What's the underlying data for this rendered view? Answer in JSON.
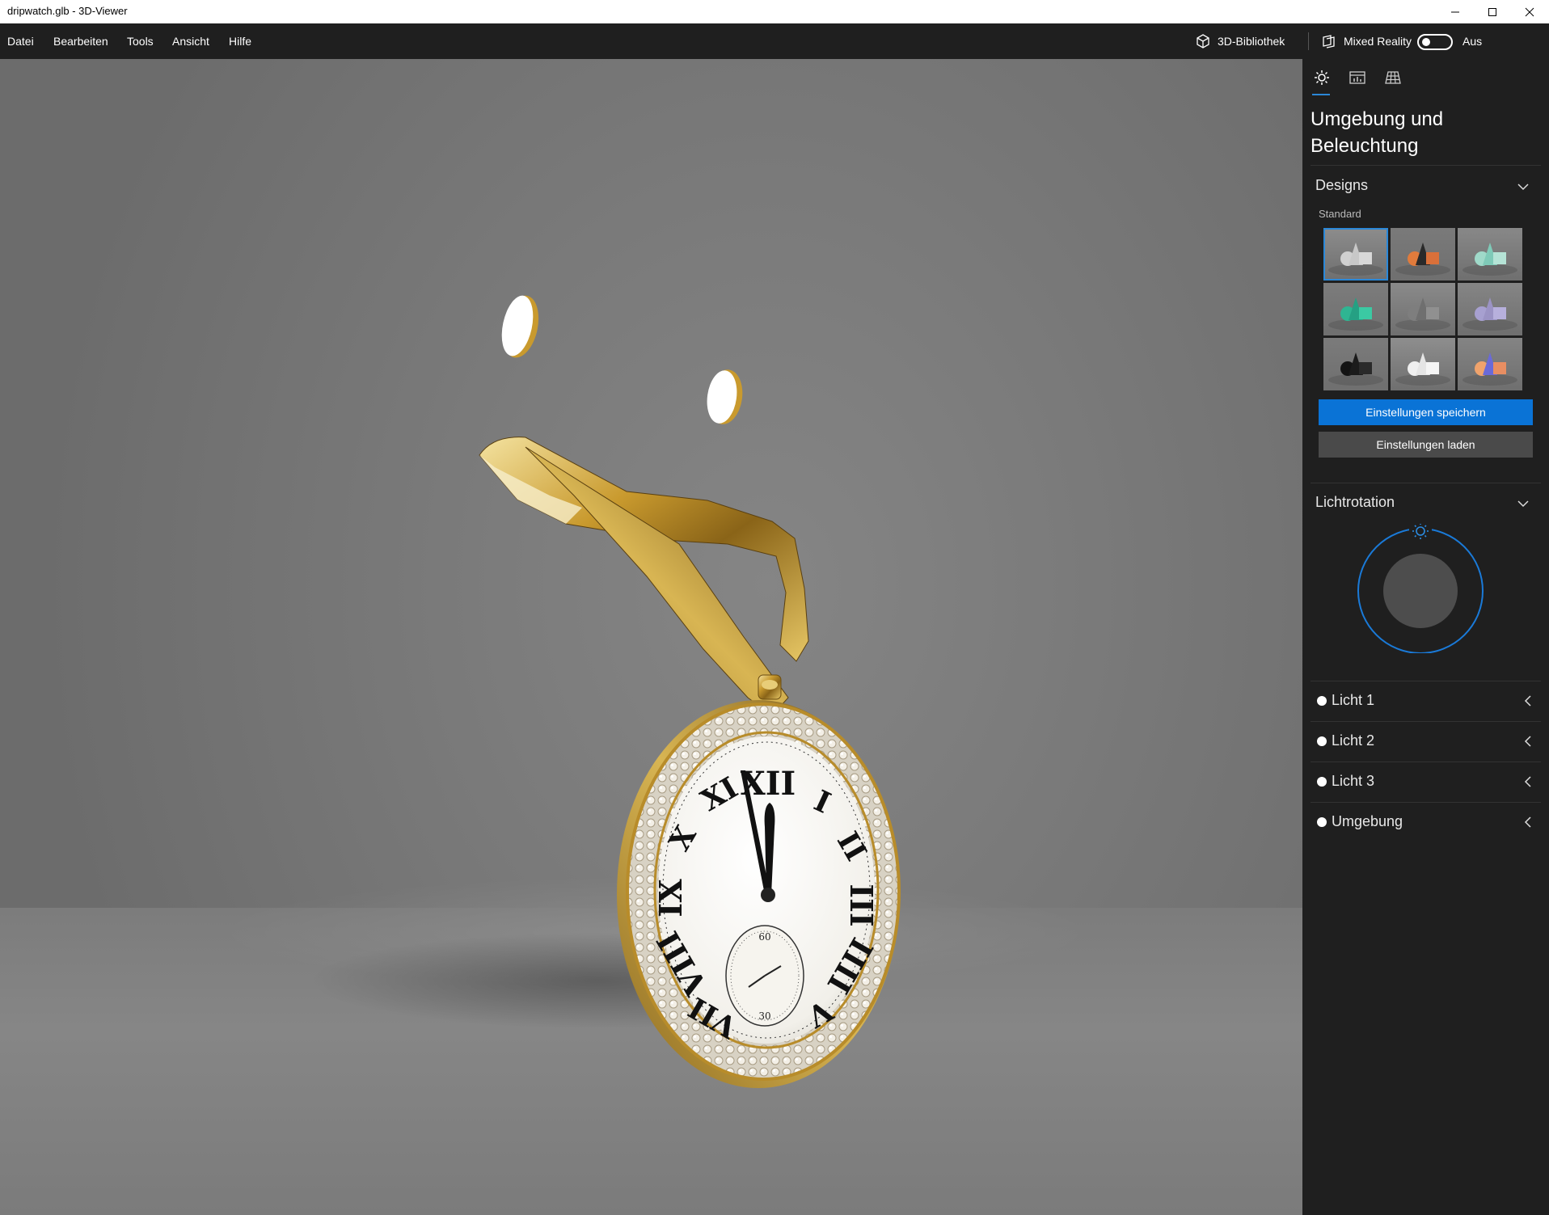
{
  "window": {
    "title": "dripwatch.glb - 3D-Viewer"
  },
  "menu": {
    "items": [
      "Datei",
      "Bearbeiten",
      "Tools",
      "Ansicht",
      "Hilfe"
    ],
    "library_label": "3D-Bibliothek",
    "mixed_reality_label": "Mixed Reality",
    "toggle_state_label": "Aus",
    "mixed_reality_on": false
  },
  "panel": {
    "tabs": [
      "environment-lighting",
      "stats-shading",
      "grid"
    ],
    "active_tab": 0,
    "title": "Umgebung und Beleuchtung",
    "designs": {
      "heading": "Designs",
      "group_label": "Standard",
      "selected_index": 0,
      "themes": [
        {
          "bg": "#8c8c8c",
          "colors": [
            "#d0d0d0",
            "#c8c8c8",
            "#d8d8d8"
          ]
        },
        {
          "bg": "#7a7a7a",
          "colors": [
            "#e07b3c",
            "#2a2a2a",
            "#d9703a"
          ]
        },
        {
          "bg": "#888888",
          "colors": [
            "#9fd9c9",
            "#7fcab8",
            "#b5e3d6"
          ]
        },
        {
          "bg": "#7c7c7c",
          "colors": [
            "#2fb592",
            "#25a083",
            "#3bc9a3"
          ]
        },
        {
          "bg": "#8a8a8a",
          "colors": [
            "#7e7e7e",
            "#6f6f6f",
            "#909090"
          ]
        },
        {
          "bg": "#858585",
          "colors": [
            "#a7a0d0",
            "#9b93c4",
            "#b7b0dc"
          ]
        },
        {
          "bg": "#7b7b7b",
          "colors": [
            "#141414",
            "#1b1b1b",
            "#2a2a2a"
          ]
        },
        {
          "bg": "#8e8e8e",
          "colors": [
            "#efefef",
            "#e5e5e5",
            "#f5f5f5"
          ]
        },
        {
          "bg": "#848484",
          "colors": [
            "#f0a36c",
            "#6a6ad8",
            "#e88e62"
          ]
        }
      ],
      "save_label": "Einstellungen speichern",
      "load_label": "Einstellungen laden"
    },
    "light_rotation": {
      "heading": "Lichtrotation"
    },
    "lights": [
      {
        "label": "Licht 1"
      },
      {
        "label": "Licht 2"
      },
      {
        "label": "Licht 3"
      },
      {
        "label": "Umgebung"
      }
    ]
  },
  "colors": {
    "accent": "#0a73d6",
    "titlebar_bg": "#ffffff",
    "app_bg": "#1f1f1f",
    "viewport_bg": "#7a7a7a",
    "gold": "#c9a23a"
  },
  "icons": [
    "cube-icon",
    "mixed-reality-icon",
    "sun-icon",
    "stats-icon",
    "grid-icon",
    "chevron-down-icon",
    "chevron-left-icon",
    "minimize-icon",
    "maximize-icon",
    "close-icon"
  ]
}
